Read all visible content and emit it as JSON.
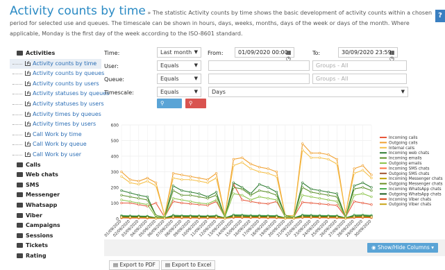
{
  "header": {
    "title": "Activity counts by time",
    "description": "» The statistic Activity counts by time shows the basic development of activity counts within a chosen period for selected use and queues. The timescale can be shown in hours, days, weeks, months, days of the week or days of the month. Where applicable, Monday is the first day of the week according to the ISO-8601 standard.",
    "help_label": "?"
  },
  "sidebar": {
    "groups": [
      {
        "label": "Activities",
        "open": true,
        "items": [
          "Activity counts by time",
          "Activity counts by queues",
          "Activity counts by users",
          "Activity statuses by queues",
          "Activity statuses by users",
          "Activity times by queues",
          "Activity times by users",
          "Call Work by time",
          "Call Work by queue",
          "Call Work by user"
        ]
      },
      {
        "label": "Calls"
      },
      {
        "label": "Web chats"
      },
      {
        "label": "SMS"
      },
      {
        "label": "Messenger"
      },
      {
        "label": "Whatsapp"
      },
      {
        "label": "Viber"
      },
      {
        "label": "Campaigns"
      },
      {
        "label": "Sessions"
      },
      {
        "label": "Tickets"
      },
      {
        "label": "Rating"
      }
    ],
    "active_item": "Activity counts by time"
  },
  "form": {
    "time_label": "Time:",
    "time_value": "Last month",
    "from_label": "From:",
    "from_value": "01/09/2020 00:00",
    "to_label": "To:",
    "to_value": "30/09/2020 23:59",
    "user_label": "User:",
    "user_op": "Equals",
    "user_value": "",
    "groups_placeholder_1": "Groups - All",
    "queue_label": "Queue:",
    "queue_op": "Equals",
    "queue_value": "",
    "groups_placeholder_2": "Groups - All",
    "timescale_label": "Timescale:",
    "timescale_op": "Equals",
    "timescale_value": "Days",
    "search_label": "Search",
    "clear_label": "Clear"
  },
  "chart_data": {
    "type": "line",
    "yticks": [
      0,
      100,
      200,
      300,
      400,
      500,
      600
    ],
    "ylim": [
      0,
      600
    ],
    "x": [
      "01/09/2020",
      "02/09/2020",
      "03/09/2020",
      "04/09/2020",
      "05/09/2020",
      "06/09/2020",
      "07/09/2020",
      "08/09/2020",
      "09/09/2020",
      "10/09/2020",
      "11/09/2020",
      "12/09/2020",
      "13/09/2020",
      "14/09/2020",
      "15/09/2020",
      "16/09/2020",
      "17/09/2020",
      "18/09/2020",
      "19/09/2020",
      "20/09/2020",
      "21/09/2020",
      "22/09/2020",
      "23/09/2020",
      "24/09/2020",
      "25/09/2020",
      "26/09/2020",
      "27/09/2020",
      "28/09/2020",
      "29/09/2020",
      "30/09/2020"
    ],
    "series": [
      {
        "name": "Incoming calls",
        "color": "#e8573a",
        "values": [
          100,
          100,
          90,
          80,
          100,
          10,
          110,
          100,
          95,
          90,
          85,
          110,
          10,
          220,
          120,
          110,
          100,
          95,
          110,
          10,
          10,
          105,
          100,
          95,
          90,
          85,
          10,
          110,
          100,
          90
        ]
      },
      {
        "name": "Outgoing calls",
        "color": "#f0a030",
        "values": [
          300,
          250,
          240,
          260,
          230,
          20,
          290,
          280,
          270,
          260,
          250,
          290,
          20,
          380,
          390,
          350,
          330,
          320,
          300,
          20,
          20,
          480,
          420,
          420,
          410,
          380,
          30,
          320,
          340,
          280
        ]
      },
      {
        "name": "Internal calls",
        "color": "#f5c04a",
        "values": [
          270,
          230,
          220,
          240,
          210,
          20,
          260,
          250,
          250,
          240,
          230,
          260,
          20,
          340,
          360,
          320,
          300,
          290,
          270,
          20,
          20,
          440,
          390,
          390,
          380,
          350,
          30,
          290,
          310,
          260
        ]
      },
      {
        "name": "Incoming web chats",
        "color": "#2e7d32",
        "values": [
          180,
          165,
          150,
          140,
          20,
          10,
          210,
          180,
          170,
          160,
          140,
          170,
          10,
          230,
          200,
          160,
          220,
          200,
          170,
          20,
          10,
          230,
          190,
          180,
          170,
          160,
          10,
          210,
          230,
          200
        ]
      },
      {
        "name": "Incoming emails",
        "color": "#5b8f29",
        "values": [
          150,
          140,
          130,
          120,
          20,
          10,
          180,
          150,
          150,
          140,
          130,
          150,
          10,
          200,
          190,
          150,
          180,
          170,
          150,
          20,
          10,
          200,
          170,
          160,
          150,
          140,
          10,
          190,
          200,
          180
        ]
      },
      {
        "name": "Outgoing emails",
        "color": "#8bc34a",
        "values": [
          120,
          110,
          100,
          90,
          10,
          10,
          130,
          120,
          110,
          100,
          95,
          120,
          10,
          160,
          150,
          120,
          140,
          130,
          120,
          10,
          10,
          150,
          140,
          130,
          120,
          110,
          10,
          150,
          160,
          140
        ]
      },
      {
        "name": "Incoming SMS chats",
        "color": "#ff7043",
        "values": [
          5,
          4,
          4,
          3,
          2,
          2,
          6,
          5,
          5,
          4,
          4,
          5,
          2,
          8,
          7,
          6,
          6,
          5,
          5,
          2,
          2,
          8,
          7,
          6,
          6,
          5,
          2,
          7,
          8,
          6
        ]
      },
      {
        "name": "Outgoing SMS chats",
        "color": "#a0522d",
        "values": [
          10,
          9,
          8,
          8,
          4,
          3,
          12,
          10,
          10,
          9,
          8,
          10,
          3,
          15,
          14,
          12,
          12,
          11,
          10,
          3,
          3,
          14,
          13,
          12,
          11,
          10,
          3,
          13,
          14,
          12
        ]
      },
      {
        "name": "Incoming Messenger chats",
        "color": "#c0a000",
        "values": [
          8,
          7,
          7,
          6,
          3,
          3,
          9,
          8,
          8,
          7,
          7,
          8,
          3,
          11,
          10,
          9,
          9,
          8,
          8,
          3,
          3,
          10,
          9,
          9,
          8,
          8,
          3,
          10,
          11,
          9
        ]
      },
      {
        "name": "Outgoing Messenger chats",
        "color": "#6b8e23",
        "values": [
          12,
          11,
          10,
          10,
          5,
          4,
          14,
          12,
          12,
          11,
          10,
          12,
          4,
          16,
          15,
          13,
          13,
          12,
          12,
          4,
          4,
          15,
          14,
          13,
          12,
          12,
          4,
          14,
          15,
          13
        ]
      },
      {
        "name": "Incoming WhatsApp chats",
        "color": "#4caf50",
        "values": [
          20,
          18,
          17,
          16,
          6,
          5,
          22,
          20,
          19,
          18,
          17,
          20,
          5,
          25,
          24,
          21,
          21,
          20,
          19,
          5,
          5,
          24,
          22,
          21,
          20,
          19,
          5,
          23,
          24,
          21
        ]
      },
      {
        "name": "Outgoing WhatsApp chats",
        "color": "#1b5e20",
        "values": [
          15,
          14,
          13,
          12,
          5,
          4,
          17,
          15,
          15,
          14,
          13,
          15,
          4,
          19,
          18,
          16,
          16,
          15,
          15,
          4,
          4,
          18,
          17,
          16,
          15,
          15,
          4,
          17,
          18,
          16
        ]
      },
      {
        "name": "Incoming Viber chats",
        "color": "#d84315",
        "values": [
          6,
          5,
          5,
          5,
          2,
          2,
          7,
          6,
          6,
          5,
          5,
          6,
          2,
          8,
          8,
          7,
          7,
          6,
          6,
          2,
          2,
          8,
          7,
          7,
          6,
          6,
          2,
          7,
          8,
          7
        ]
      },
      {
        "name": "Outgoing Viber chats",
        "color": "#c8a415",
        "values": [
          9,
          8,
          8,
          7,
          3,
          3,
          10,
          9,
          9,
          8,
          8,
          9,
          3,
          12,
          11,
          10,
          10,
          9,
          9,
          3,
          3,
          11,
          10,
          10,
          9,
          9,
          3,
          11,
          12,
          10
        ]
      }
    ]
  },
  "bottom": {
    "show_hide_label": "Show/Hide Columns",
    "export_pdf": "Export to PDF",
    "export_excel": "Export to Excel"
  }
}
